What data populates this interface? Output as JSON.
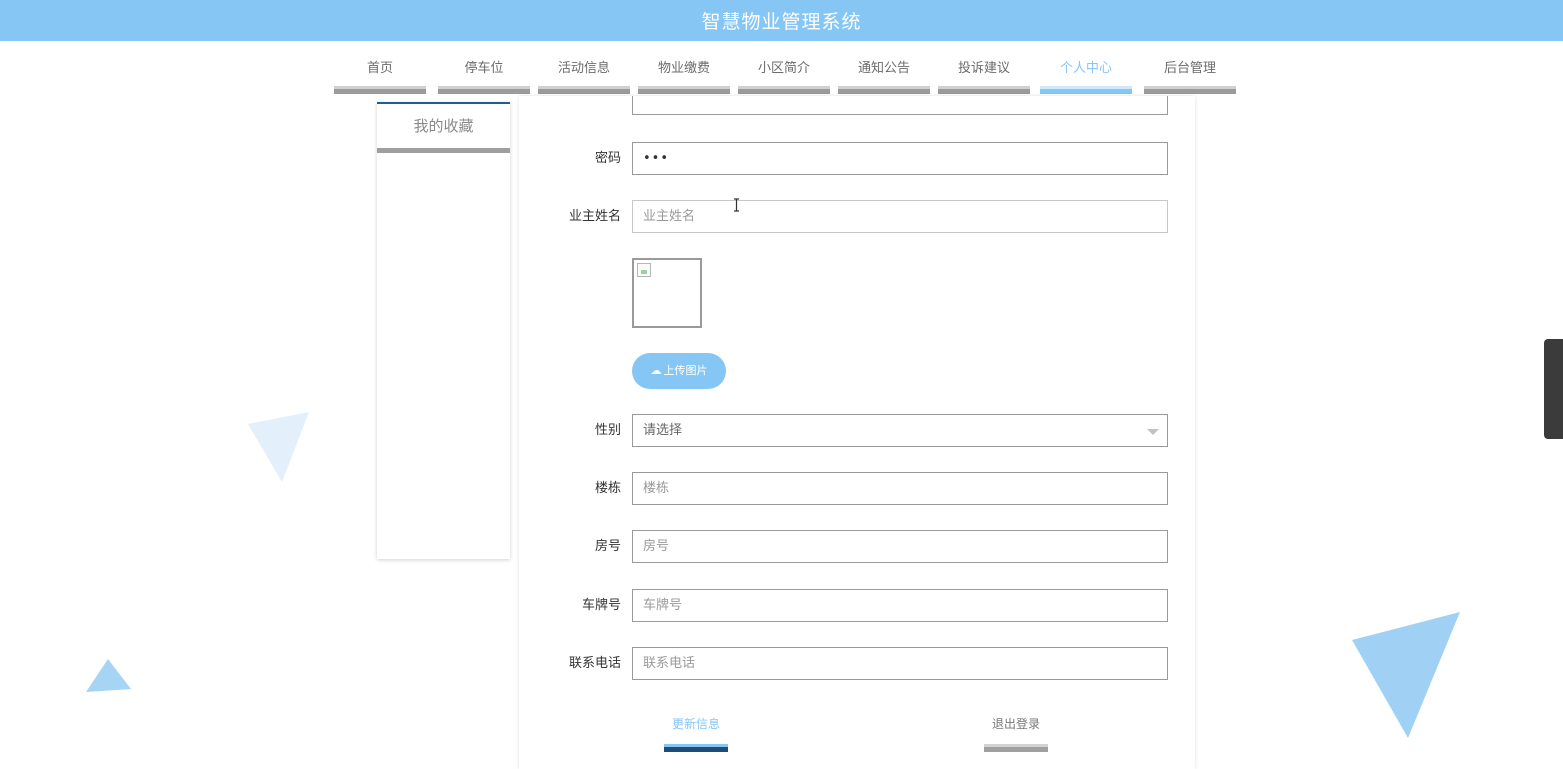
{
  "header": {
    "title": "智慧物业管理系统"
  },
  "nav": {
    "items": [
      {
        "label": "首页"
      },
      {
        "label": "停车位"
      },
      {
        "label": "活动信息"
      },
      {
        "label": "物业缴费"
      },
      {
        "label": "小区简介"
      },
      {
        "label": "通知公告"
      },
      {
        "label": "投诉建议"
      },
      {
        "label": "个人中心"
      },
      {
        "label": "后台管理"
      }
    ],
    "active_label": "个人中心"
  },
  "sidebar": {
    "items": [
      {
        "label": "我的收藏"
      }
    ]
  },
  "form": {
    "password": {
      "label": "密码",
      "value": "•••"
    },
    "owner_name": {
      "label": "业主姓名",
      "placeholder": "业主姓名"
    },
    "image": {
      "upload_label": "上传图片",
      "icon": "cloud-upload-icon"
    },
    "gender": {
      "label": "性别",
      "selected": "请选择"
    },
    "building": {
      "label": "楼栋",
      "placeholder": "楼栋"
    },
    "room": {
      "label": "房号",
      "placeholder": "房号"
    },
    "plate": {
      "label": "车牌号",
      "placeholder": "车牌号"
    },
    "phone": {
      "label": "联系电话",
      "placeholder": "联系电话"
    }
  },
  "actions": {
    "update": "更新信息",
    "logout": "退出登录"
  },
  "colors": {
    "accent": "#86c6f4",
    "dark_accent": "#1d4e7a",
    "triangle_light": "#e6f1fb",
    "triangle_mid": "#9fd1f4"
  }
}
